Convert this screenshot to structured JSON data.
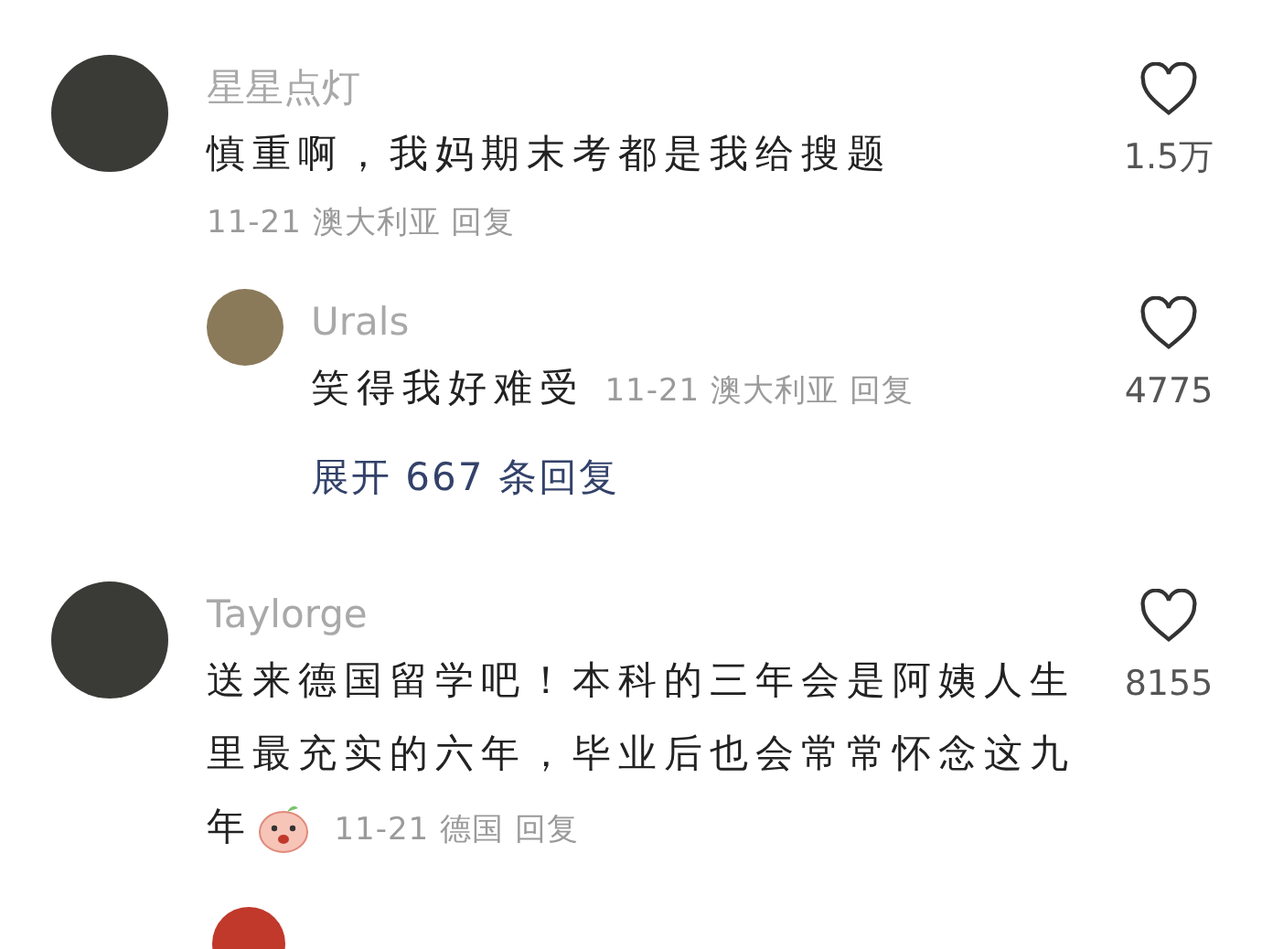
{
  "comments": [
    {
      "name": "星星点灯",
      "lines": [
        "慎重啊，我妈期末考都是我给搜题"
      ],
      "date": "11-21",
      "location": "澳大利亚",
      "reply": "回复",
      "likes": "1.5万",
      "inline_meta": false,
      "replies": [
        {
          "name": "Urals",
          "lines": [
            "笑得我好难受"
          ],
          "date": "11-21",
          "location": "澳大利亚",
          "reply": "回复",
          "likes": "4775",
          "inline_meta": true
        }
      ],
      "expand": "展开 667 条回复"
    },
    {
      "name": "Taylorge",
      "lines": [
        "送来德国留学吧！本科的三年会是阿姨人生",
        "里最充实的六年，毕业后也会常常怀念这九",
        "年"
      ],
      "sticker": true,
      "date": "11-21",
      "location": "德国",
      "reply": "回复",
      "likes": "8155",
      "inline_meta": true
    }
  ]
}
